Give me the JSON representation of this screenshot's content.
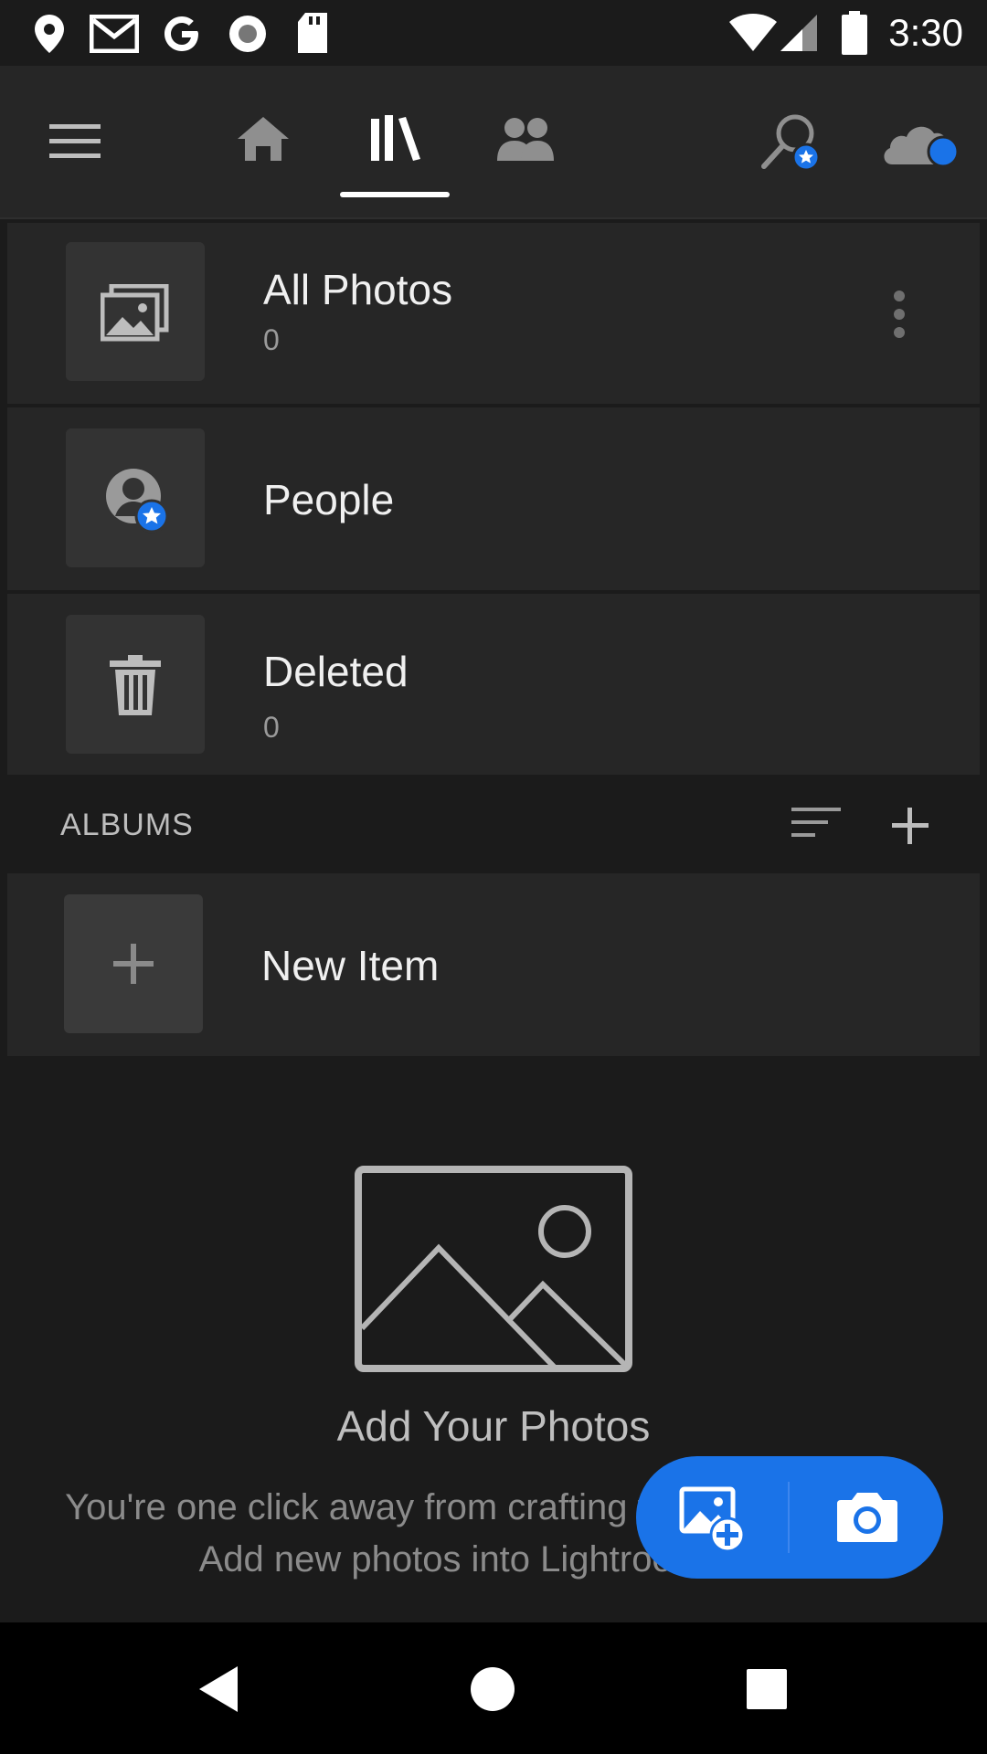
{
  "status_bar": {
    "time": "3:30",
    "left_icons": [
      "location-pin-icon",
      "gmail-icon",
      "google-icon",
      "record-icon",
      "sd-card-icon"
    ],
    "right_icons": [
      "wifi-icon",
      "cellular-signal-icon",
      "battery-icon"
    ]
  },
  "app_bar": {
    "tabs": [
      {
        "name": "home-icon",
        "selected": false
      },
      {
        "name": "library-icon",
        "selected": true
      },
      {
        "name": "people-icon",
        "selected": false
      }
    ],
    "actions": [
      "search-icon",
      "cloud-sync-icon"
    ],
    "accent_color": "#1a73e8"
  },
  "library": [
    {
      "title": "All Photos",
      "count": "0",
      "icon": "photos-stack-icon",
      "has_menu": true
    },
    {
      "title": "People",
      "count": "",
      "icon": "person-star-icon",
      "has_menu": false
    },
    {
      "title": "Deleted",
      "count": "0",
      "icon": "trash-icon",
      "has_menu": false
    }
  ],
  "albums": {
    "header": "ALBUMS",
    "new_item": "New Item"
  },
  "empty_state": {
    "title": "Add Your Photos",
    "description": "You're one click away from crafting from your photos. Add new photos into Lightroom now."
  },
  "fab": {
    "actions": [
      "add-photo-icon",
      "camera-icon"
    ]
  },
  "nav_bar": [
    "back-icon",
    "home-circle-icon",
    "recents-icon"
  ]
}
